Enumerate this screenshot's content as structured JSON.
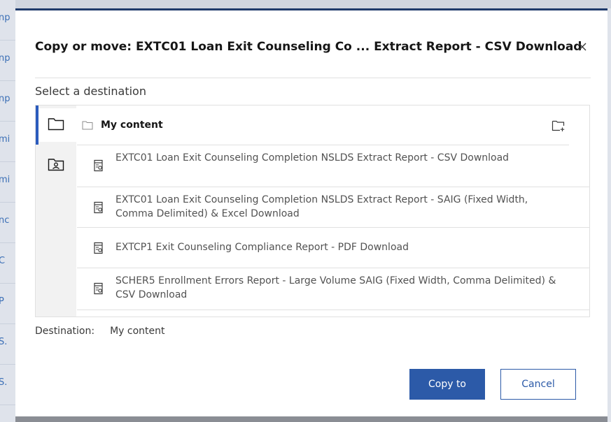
{
  "background": {
    "fragments": [
      "np",
      "np",
      "np",
      "mi",
      "mi",
      "nc",
      "C",
      "P",
      "S.",
      "S."
    ]
  },
  "dialog": {
    "title": "Copy or move:  EXTC01 Loan Exit Counseling Co ... Extract Report - CSV Download",
    "close_icon": "close-icon",
    "subtitle": "Select a destination",
    "rail": [
      {
        "icon": "folder-icon",
        "selected": true
      },
      {
        "icon": "user-folder-icon",
        "selected": false
      }
    ],
    "list_header": {
      "icon": "folder-icon",
      "label": "My content",
      "action_icon": "new-folder-icon"
    },
    "items": [
      {
        "icon": "report-icon",
        "label": "EXTC01 Loan Exit Counseling Completion NSLDS Extract Report - CSV Download"
      },
      {
        "icon": "report-icon",
        "label": "EXTC01 Loan Exit Counseling Completion NSLDS Extract Report - SAIG (Fixed Width, Comma Delimited) & Excel Download"
      },
      {
        "icon": "report-icon",
        "label": "EXTCP1 Exit Counseling Compliance Report - PDF Download"
      },
      {
        "icon": "report-icon",
        "label": "SCHER5 Enrollment Errors Report - Large Volume SAIG (Fixed Width, Comma Delimited) & CSV Download"
      }
    ],
    "destination": {
      "label": "Destination:",
      "value": "My content"
    },
    "buttons": {
      "primary": "Copy to",
      "secondary": "Cancel"
    },
    "colors": {
      "primary": "#2c5aa8",
      "accent_bar": "#2b5bbd",
      "header_border": "#1e3a6b"
    }
  }
}
